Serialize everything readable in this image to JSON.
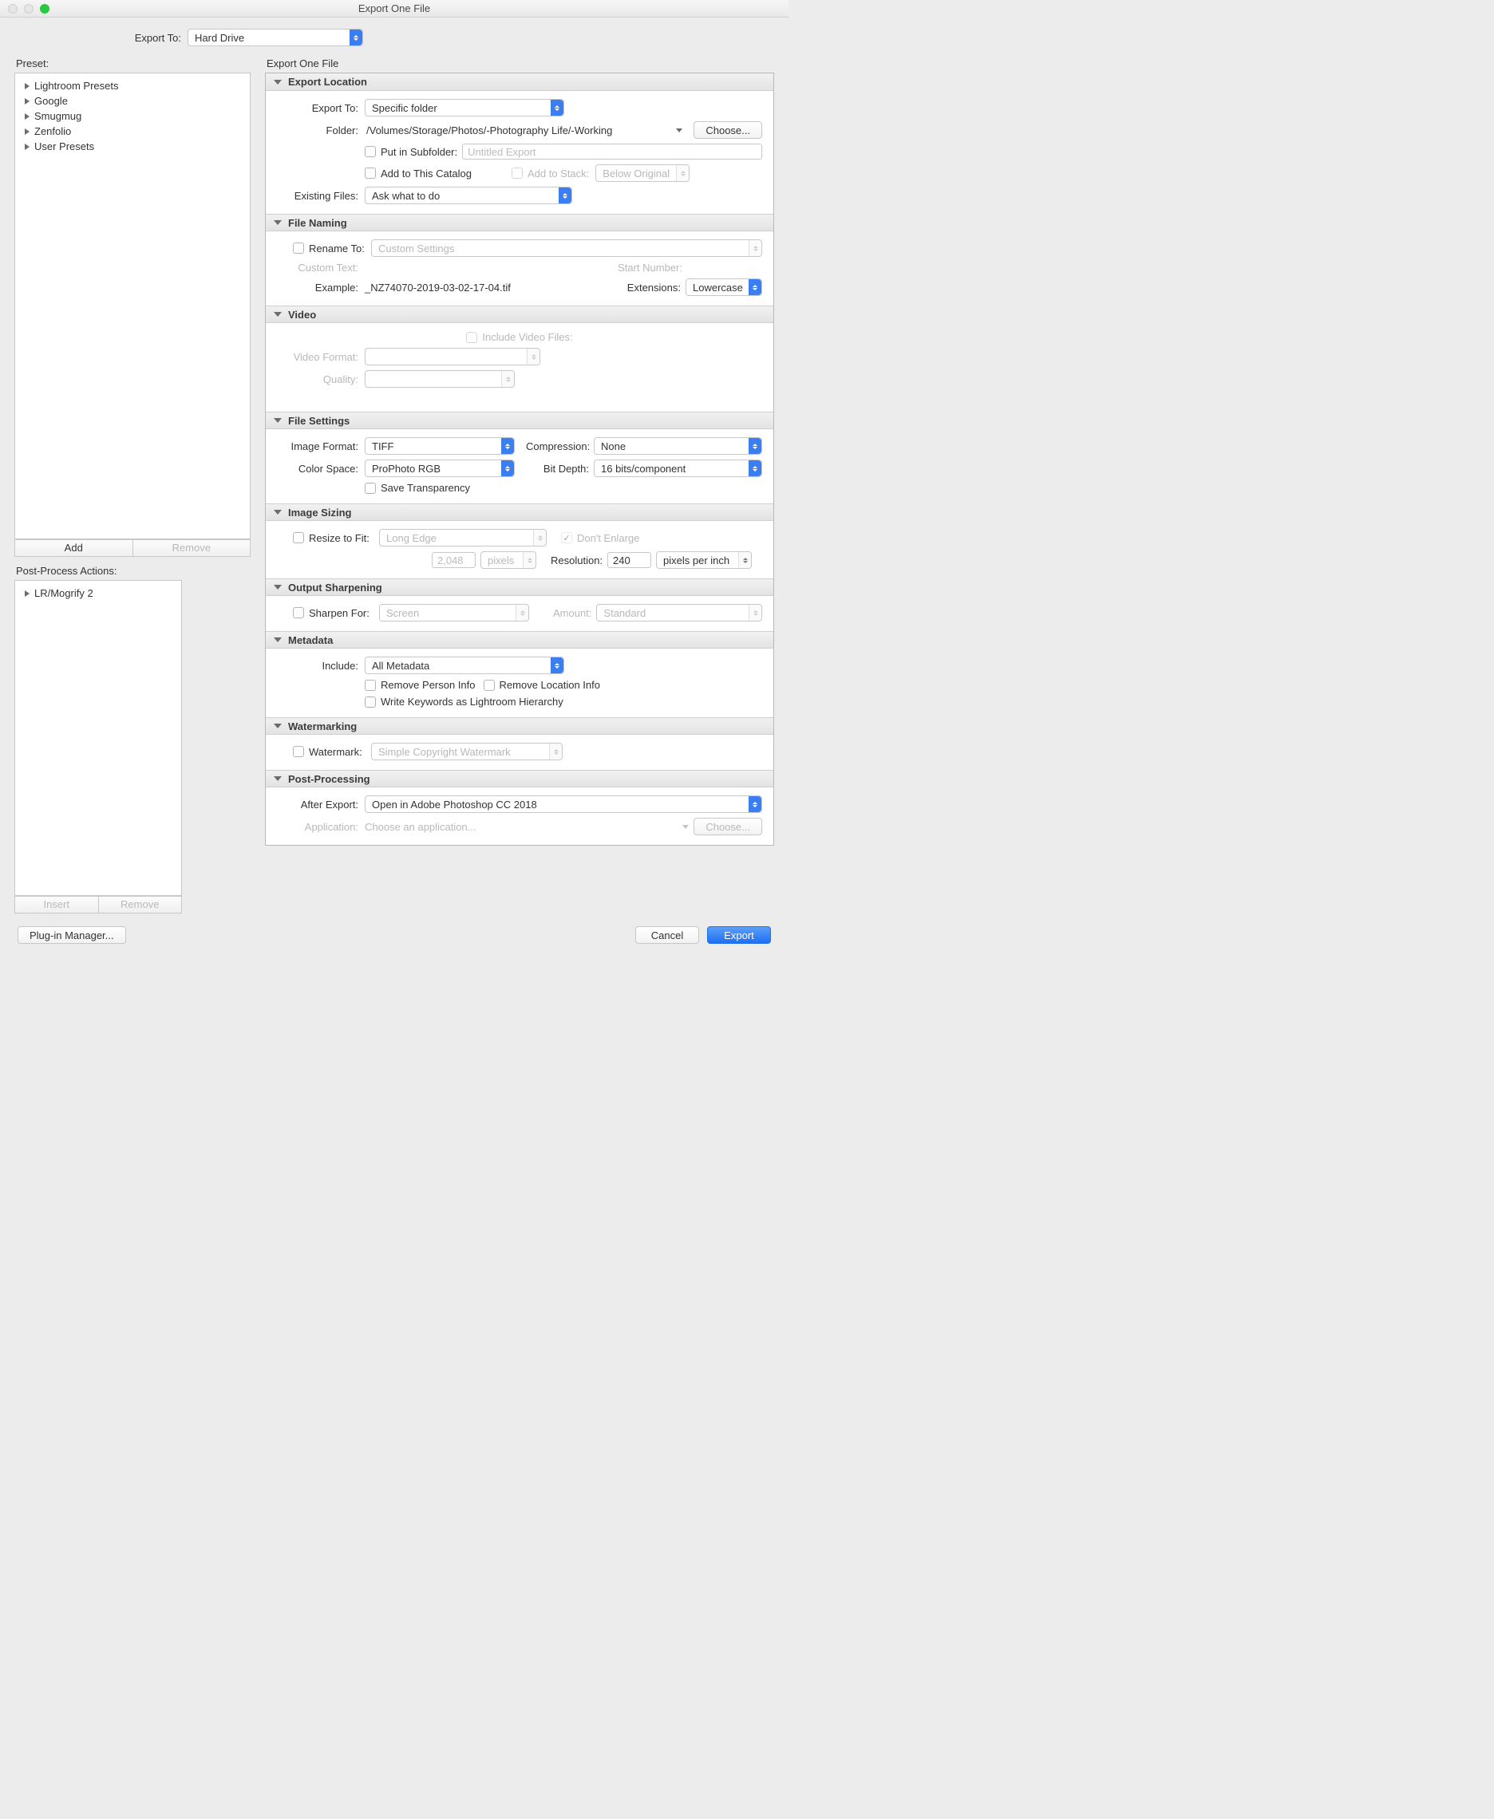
{
  "window": {
    "title": "Export One File"
  },
  "topbar": {
    "exportToLabel": "Export To:",
    "exportToValue": "Hard Drive"
  },
  "left": {
    "presetLabel": "Preset:",
    "presets": [
      "Lightroom Presets",
      "Google",
      "Smugmug",
      "Zenfolio",
      "User Presets"
    ],
    "addLabel": "Add",
    "removeLabel": "Remove",
    "ppaLabel": "Post-Process Actions:",
    "ppaItems": [
      "LR/Mogrify 2"
    ],
    "insertLabel": "Insert",
    "removeLabel2": "Remove"
  },
  "right": {
    "paneTitle": "Export One File",
    "exportLocation": {
      "title": "Export Location",
      "exportToLabel": "Export To:",
      "exportToValue": "Specific folder",
      "folderLabel": "Folder:",
      "folderPath": "/Volumes/Storage/Photos/-Photography Life/-Working",
      "chooseLabel": "Choose...",
      "putInSubfolderLabel": "Put in Subfolder:",
      "subfolderPlaceholder": "Untitled Export",
      "addToCatalogLabel": "Add to This Catalog",
      "addToStackLabel": "Add to Stack:",
      "stackValue": "Below Original",
      "existingFilesLabel": "Existing Files:",
      "existingFilesValue": "Ask what to do"
    },
    "fileNaming": {
      "title": "File Naming",
      "renameToLabel": "Rename To:",
      "renameValue": "Custom Settings",
      "customTextLabel": "Custom Text:",
      "startNumberLabel": "Start Number:",
      "exampleLabel": "Example:",
      "exampleValue": "_NZ74070-2019-03-02-17-04.tif",
      "extensionsLabel": "Extensions:",
      "extensionsValue": "Lowercase"
    },
    "video": {
      "title": "Video",
      "includeLabel": "Include Video Files:",
      "videoFormatLabel": "Video Format:",
      "qualityLabel": "Quality:"
    },
    "fileSettings": {
      "title": "File Settings",
      "imageFormatLabel": "Image Format:",
      "imageFormatValue": "TIFF",
      "compressionLabel": "Compression:",
      "compressionValue": "None",
      "colorSpaceLabel": "Color Space:",
      "colorSpaceValue": "ProPhoto RGB",
      "bitDepthLabel": "Bit Depth:",
      "bitDepthValue": "16 bits/component",
      "saveTransparencyLabel": "Save Transparency"
    },
    "imageSizing": {
      "title": "Image Sizing",
      "resizeLabel": "Resize to Fit:",
      "resizeValue": "Long Edge",
      "dontEnlargeLabel": "Don't Enlarge",
      "sizeValue": "2,048",
      "sizeUnit": "pixels",
      "resolutionLabel": "Resolution:",
      "resolutionValue": "240",
      "resolutionUnit": "pixels per inch"
    },
    "outputSharpening": {
      "title": "Output Sharpening",
      "sharpenForLabel": "Sharpen For:",
      "sharpenForValue": "Screen",
      "amountLabel": "Amount:",
      "amountValue": "Standard"
    },
    "metadata": {
      "title": "Metadata",
      "includeLabel": "Include:",
      "includeValue": "All Metadata",
      "removePersonLabel": "Remove Person Info",
      "removeLocationLabel": "Remove Location Info",
      "writeKeywordsLabel": "Write Keywords as Lightroom Hierarchy"
    },
    "watermarking": {
      "title": "Watermarking",
      "watermarkLabel": "Watermark:",
      "watermarkValue": "Simple Copyright Watermark"
    },
    "postProcessing": {
      "title": "Post-Processing",
      "afterExportLabel": "After Export:",
      "afterExportValue": "Open in Adobe Photoshop CC 2018",
      "applicationLabel": "Application:",
      "applicationPlaceholder": "Choose an application...",
      "chooseLabel": "Choose..."
    }
  },
  "footer": {
    "pluginManager": "Plug-in Manager...",
    "cancel": "Cancel",
    "export": "Export"
  }
}
